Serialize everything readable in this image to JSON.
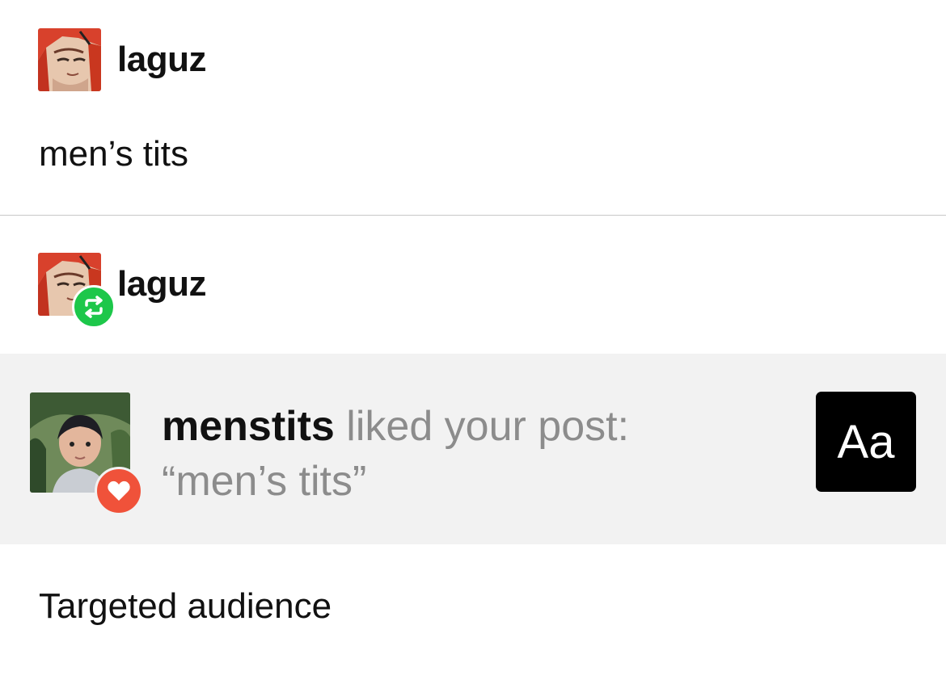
{
  "original_post": {
    "username": "laguz",
    "text": "men’s tits"
  },
  "reblog": {
    "username": "laguz",
    "badge_icon": "reblog-icon",
    "badge_color": "#1dc74a"
  },
  "notification": {
    "username": "menstits",
    "action": " liked your post:",
    "quote": "“men’s tits”",
    "badge_icon": "heart-icon",
    "badge_color": "#f0523a",
    "thumbnail_label": "Aa"
  },
  "caption": "Targeted audience"
}
